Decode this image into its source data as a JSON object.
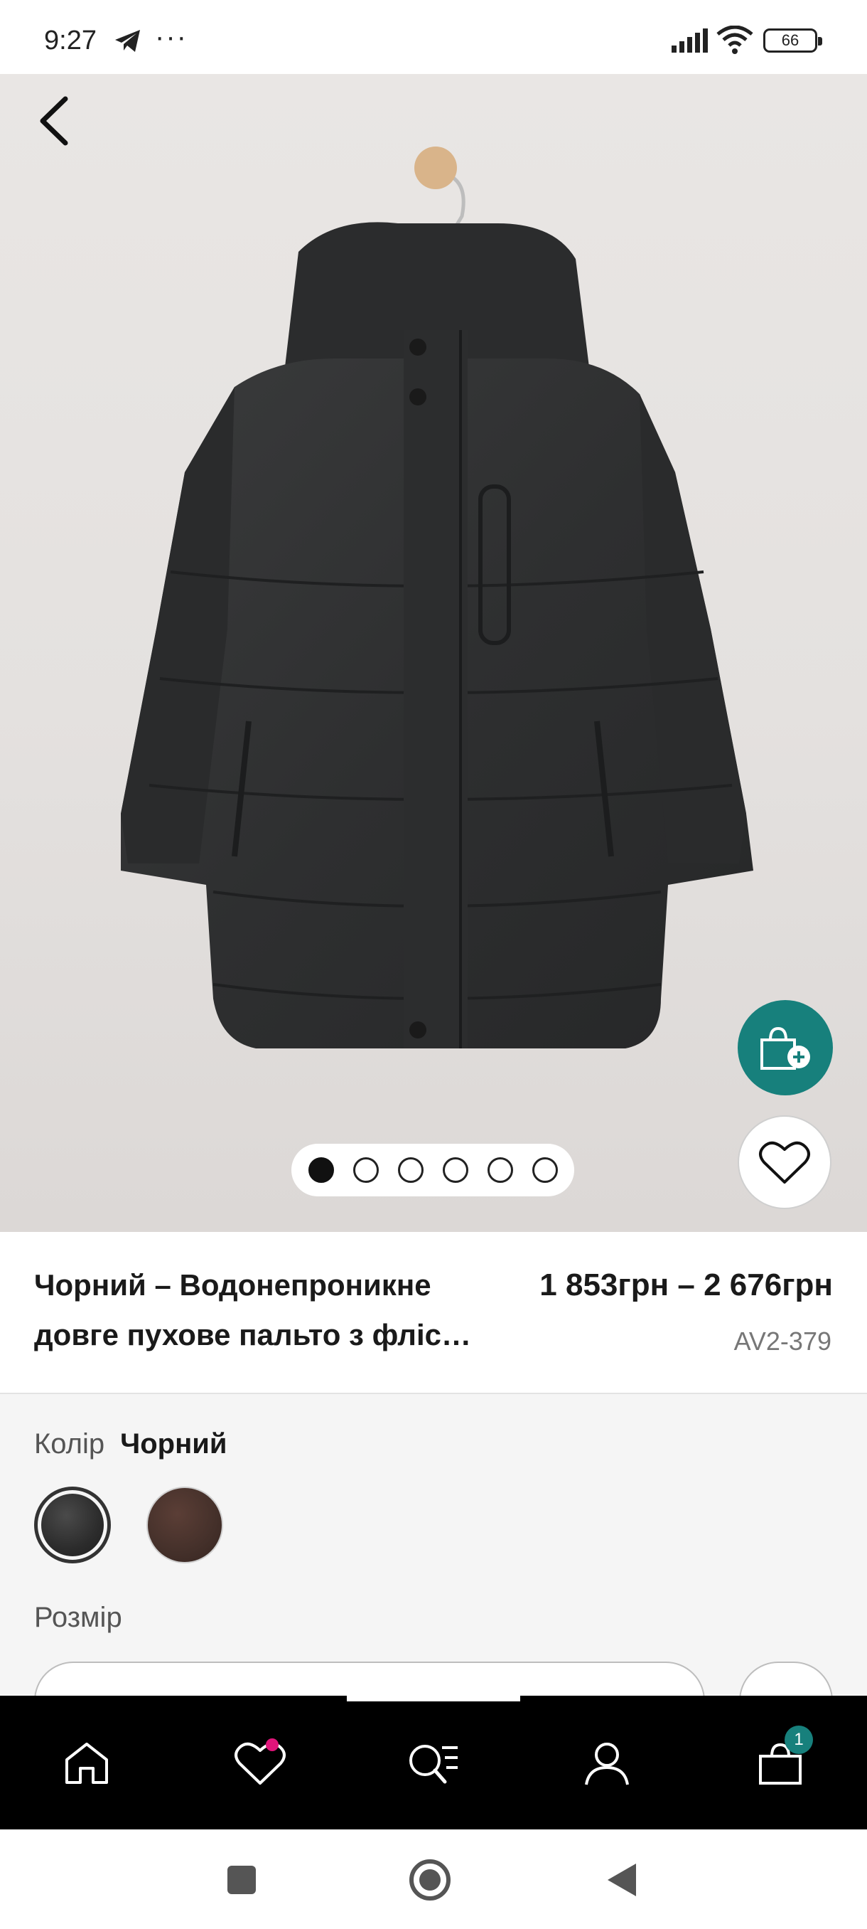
{
  "status_bar": {
    "time": "9:27",
    "more": "···",
    "battery": "66"
  },
  "product": {
    "title_line1": "Чорний – Водонепроникне",
    "title_line2": "довге пухове пальто з фліс…",
    "price": "1 853грн – 2 676грн",
    "sku": "AV2-379"
  },
  "gallery": {
    "image_count": 6,
    "active_index": 0
  },
  "options": {
    "color_label": "Колір",
    "color_value": "Чорний",
    "colors": [
      "Чорний",
      "Коричневий"
    ],
    "size_label": "Розмір"
  },
  "bottom_nav": {
    "items": [
      "home",
      "wishlist",
      "search",
      "account",
      "bag"
    ],
    "cart_count": "1"
  },
  "colors": {
    "accent": "#17807c",
    "wishlist_dot": "#e0157a",
    "nav_bg": "#000000"
  }
}
